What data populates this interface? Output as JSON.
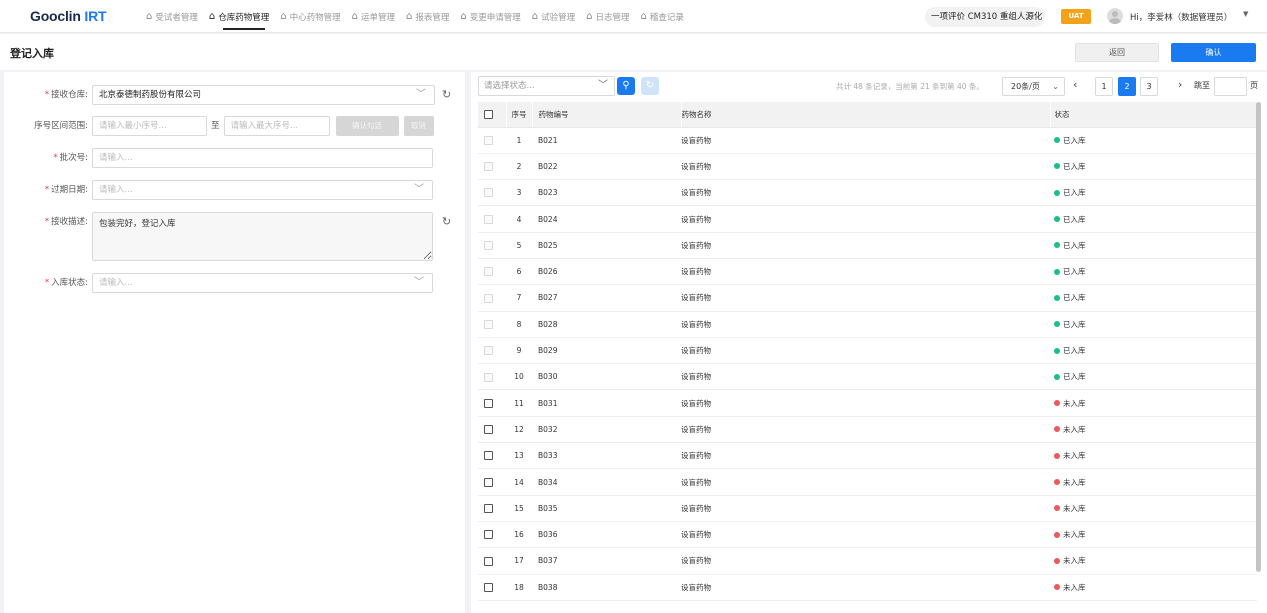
{
  "app": {
    "logo_main": "Gooclin",
    "logo_accent": "IRT"
  },
  "nav": {
    "items": [
      {
        "label": "受试者管理",
        "active": false
      },
      {
        "label": "仓库药物管理",
        "active": true
      },
      {
        "label": "中心药物管理",
        "active": false
      },
      {
        "label": "运单管理",
        "active": false
      },
      {
        "label": "报表管理",
        "active": false
      },
      {
        "label": "变更申请管理",
        "active": false
      },
      {
        "label": "试验管理",
        "active": false
      },
      {
        "label": "日志管理",
        "active": false
      },
      {
        "label": "稽查记录",
        "active": false
      }
    ],
    "project": "一项评价 CM310 重组人源化",
    "env_badge": "UAT",
    "user": "Hi，李爱林（数据管理员）",
    "colors": {
      "accent": "#1a7bf0",
      "badge": "#f5a21b"
    }
  },
  "header": {
    "title": "登记入库",
    "back_label": "返回",
    "confirm_label": "确认"
  },
  "form": {
    "warehouse": {
      "label": "接收仓库:",
      "value": "北京泰德制药股份有限公司",
      "required": true
    },
    "range": {
      "label": "序号区间范围:",
      "min_placeholder": "请输入最小序号...",
      "separator": "至",
      "max_placeholder": "请输入最大序号...",
      "confirm_btn": "确认勾选",
      "cancel_btn": "取消"
    },
    "batch": {
      "label": "批次号:",
      "placeholder": "请输入...",
      "required": true
    },
    "expiry": {
      "label": "过期日期:",
      "placeholder": "请输入...",
      "required": true
    },
    "desc": {
      "label": "接收描述:",
      "value": "包装完好，登记入库",
      "required": true
    },
    "status": {
      "label": "入库状态:",
      "placeholder": "请输入...",
      "required": true
    }
  },
  "list": {
    "status_filter_placeholder": "请选择状态...",
    "pagination": {
      "info": "共计 48 条记录，当前第 21 条到第 40 条。",
      "page_size": "20条/页",
      "pages": [
        "1",
        "2",
        "3"
      ],
      "current_page": "2",
      "jump_label": "跳至",
      "page_suffix": "页"
    },
    "columns": [
      "序号",
      "药物编号",
      "药物名称",
      "状态"
    ],
    "status_colors": {
      "已入库": "#1bbf8a",
      "未入库": "#f0575a"
    },
    "rows": [
      {
        "no": "1",
        "code": "B021",
        "name": "设盲药物",
        "status": "已入库",
        "disabled": true
      },
      {
        "no": "2",
        "code": "B022",
        "name": "设盲药物",
        "status": "已入库",
        "disabled": true
      },
      {
        "no": "3",
        "code": "B023",
        "name": "设盲药物",
        "status": "已入库",
        "disabled": true
      },
      {
        "no": "4",
        "code": "B024",
        "name": "设盲药物",
        "status": "已入库",
        "disabled": true
      },
      {
        "no": "5",
        "code": "B025",
        "name": "设盲药物",
        "status": "已入库",
        "disabled": true
      },
      {
        "no": "6",
        "code": "B026",
        "name": "设盲药物",
        "status": "已入库",
        "disabled": true
      },
      {
        "no": "7",
        "code": "B027",
        "name": "设盲药物",
        "status": "已入库",
        "disabled": true
      },
      {
        "no": "8",
        "code": "B028",
        "name": "设盲药物",
        "status": "已入库",
        "disabled": true
      },
      {
        "no": "9",
        "code": "B029",
        "name": "设盲药物",
        "status": "已入库",
        "disabled": true
      },
      {
        "no": "10",
        "code": "B030",
        "name": "设盲药物",
        "status": "已入库",
        "disabled": true
      },
      {
        "no": "11",
        "code": "B031",
        "name": "设盲药物",
        "status": "未入库",
        "disabled": false
      },
      {
        "no": "12",
        "code": "B032",
        "name": "设盲药物",
        "status": "未入库",
        "disabled": false
      },
      {
        "no": "13",
        "code": "B033",
        "name": "设盲药物",
        "status": "未入库",
        "disabled": false
      },
      {
        "no": "14",
        "code": "B034",
        "name": "设盲药物",
        "status": "未入库",
        "disabled": false
      },
      {
        "no": "15",
        "code": "B035",
        "name": "设盲药物",
        "status": "未入库",
        "disabled": false
      },
      {
        "no": "16",
        "code": "B036",
        "name": "设盲药物",
        "status": "未入库",
        "disabled": false
      },
      {
        "no": "17",
        "code": "B037",
        "name": "设盲药物",
        "status": "未入库",
        "disabled": false
      },
      {
        "no": "18",
        "code": "B038",
        "name": "设盲药物",
        "status": "未入库",
        "disabled": false
      }
    ]
  }
}
